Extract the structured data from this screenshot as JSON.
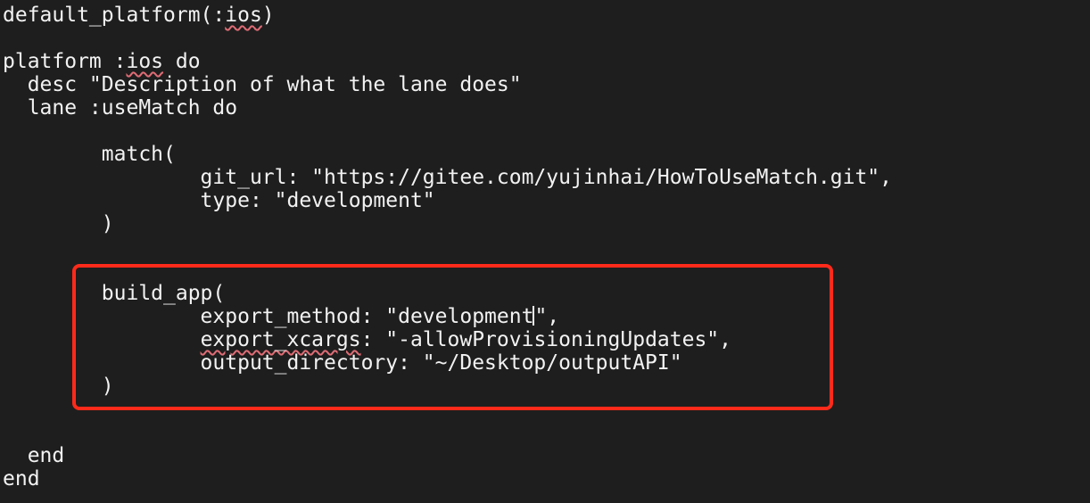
{
  "editor": {
    "highlight_color": "#ff2a1a",
    "text_color": "#f2f2f2",
    "background_color": "#1e1e1e",
    "lines": {
      "l1_prefix": "default_platform(:",
      "l1_word": "ios",
      "l1_suffix": ")",
      "l2_prefix": "platform :",
      "l2_word": "ios",
      "l2_suffix": " do",
      "l3": "  desc \"Description of what the lane does\"",
      "l4": "  lane :useMatch do",
      "l5": "        match(",
      "l6": "                git_url: \"https://gitee.com/yujinhai/HowToUseMatch.git\",",
      "l7": "                type: \"development\"",
      "l8": "        )",
      "l9": "        build_app(",
      "l10_before_cursor": "                export_method: \"development",
      "l10_after_cursor": "\",",
      "l11_indent": "                ",
      "l11_word": "export_xcargs",
      "l11_suffix": ": \"-allowProvisioningUpdates\",",
      "l12": "                output_directory: \"~/Desktop/outputAPI\"",
      "l13": "        )",
      "l14": "  end",
      "l15": "end"
    }
  }
}
